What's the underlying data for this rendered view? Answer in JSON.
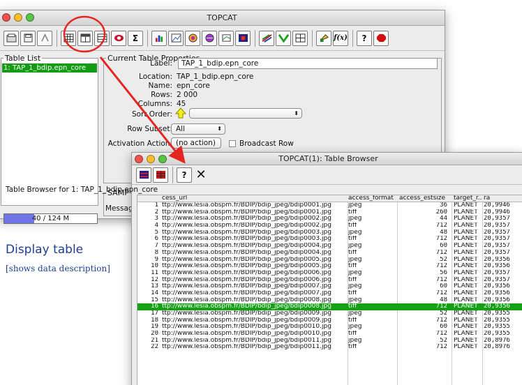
{
  "main_window": {
    "title": "TOPCAT",
    "table_list": {
      "legend": "Table List",
      "items": [
        "1: TAP_1_bdip.epn_core"
      ]
    },
    "memory": {
      "text": "40 / 124 M",
      "fraction": 0.32
    },
    "current_table": {
      "legend": "Current Table Properties",
      "label_caption": "Label:",
      "label_value": "TAP_1_bdip.epn_core",
      "location_caption": "Location:",
      "location_value": "TAP_1_bdip.epn_core",
      "name_caption": "Name:",
      "name_value": "epn_core",
      "rows_caption": "Rows:",
      "rows_value": "2 000",
      "columns_caption": "Columns:",
      "columns_value": "45",
      "sort_caption": "Sort Order:",
      "subset_caption": "Row Subset:",
      "subset_value": "All",
      "activation_caption": "Activation Action:",
      "activation_value": "(no action)",
      "broadcast_label": "Broadcast Row"
    },
    "samp_legend": "SAMP",
    "samp_message": "Messag"
  },
  "callout": {
    "heading": "Display table",
    "subheading": "[shows data description]",
    "colors": {
      "highlight_ring": "#e52521",
      "arrow": "#e52521",
      "text": "#1e3e93"
    }
  },
  "browser_window": {
    "title": "TOPCAT(1): Table Browser",
    "caption": "Table Browser for 1: TAP_1_bdip.epn_core",
    "columns": [
      "",
      "cess_url",
      "access_format",
      "access_estsize",
      "target_r...",
      "ra"
    ],
    "selected_index": 15,
    "rows": [
      {
        "idx": "1",
        "url": "ttp://www.lesia.obspm.fr/BDIP/bdip_jpeg/bdip0001.jpg",
        "format": "jpeg",
        "size": "36",
        "target": "PLANET",
        "ra": "20,9946"
      },
      {
        "idx": "2",
        "url": "ttp://www.lesia.obspm.fr/BDIP/bdip_jpeg/bdip0001.jpg",
        "format": "tiff",
        "size": "260",
        "target": "PLANET",
        "ra": "20,9946"
      },
      {
        "idx": "3",
        "url": "ttp://www.lesia.obspm.fr/BDIP/bdip_jpeg/bdip0002.jpg",
        "format": "jpeg",
        "size": "44",
        "target": "PLANET",
        "ra": "20,9357"
      },
      {
        "idx": "4",
        "url": "ttp://www.lesia.obspm.fr/BDIP/bdip_jpeg/bdip0002.jpg",
        "format": "tiff",
        "size": "712",
        "target": "PLANET",
        "ra": "20,9357"
      },
      {
        "idx": "5",
        "url": "ttp://www.lesia.obspm.fr/BDIP/bdip_jpeg/bdip0003.jpg",
        "format": "jpeg",
        "size": "48",
        "target": "PLANET",
        "ra": "20,9357"
      },
      {
        "idx": "6",
        "url": "ttp://www.lesia.obspm.fr/BDIP/bdip_jpeg/bdip0003.jpg",
        "format": "tiff",
        "size": "712",
        "target": "PLANET",
        "ra": "20,9357"
      },
      {
        "idx": "7",
        "url": "ttp://www.lesia.obspm.fr/BDIP/bdip_jpeg/bdip0004.jpg",
        "format": "jpeg",
        "size": "60",
        "target": "PLANET",
        "ra": "20,9357"
      },
      {
        "idx": "8",
        "url": "ttp://www.lesia.obspm.fr/BDIP/bdip_jpeg/bdip0004.jpg",
        "format": "tiff",
        "size": "712",
        "target": "PLANET",
        "ra": "20,9357"
      },
      {
        "idx": "9",
        "url": "ttp://www.lesia.obspm.fr/BDIP/bdip_jpeg/bdip0005.jpg",
        "format": "jpeg",
        "size": "52",
        "target": "PLANET",
        "ra": "20,9356"
      },
      {
        "idx": "10",
        "url": "ttp://www.lesia.obspm.fr/BDIP/bdip_jpeg/bdip0005.jpg",
        "format": "tiff",
        "size": "712",
        "target": "PLANET",
        "ra": "20,9356"
      },
      {
        "idx": "11",
        "url": "ttp://www.lesia.obspm.fr/BDIP/bdip_jpeg/bdip0006.jpg",
        "format": "jpeg",
        "size": "56",
        "target": "PLANET",
        "ra": "20,9357"
      },
      {
        "idx": "12",
        "url": "ttp://www.lesia.obspm.fr/BDIP/bdip_jpeg/bdip0006.jpg",
        "format": "tiff",
        "size": "712",
        "target": "PLANET",
        "ra": "20,9357"
      },
      {
        "idx": "13",
        "url": "ttp://www.lesia.obspm.fr/BDIP/bdip_jpeg/bdip0007.jpg",
        "format": "jpeg",
        "size": "60",
        "target": "PLANET",
        "ra": "20,9356"
      },
      {
        "idx": "14",
        "url": "ttp://www.lesia.obspm.fr/BDIP/bdip_jpeg/bdip0007.jpg",
        "format": "tiff",
        "size": "712",
        "target": "PLANET",
        "ra": "20,9356"
      },
      {
        "idx": "15",
        "url": "ttp://www.lesia.obspm.fr/BDIP/bdip_jpeg/bdip0008.jpg",
        "format": "jpeg",
        "size": "48",
        "target": "PLANET",
        "ra": "20,9356"
      },
      {
        "idx": "16",
        "url": "ttp://www.lesia.obspm.fr/BDIP/bdip_jpeg/bdip0008.jpg",
        "format": "tiff",
        "size": "712",
        "target": "PLANET",
        "ra": "20,9356"
      },
      {
        "idx": "17",
        "url": "ttp://www.lesia.obspm.fr/BDIP/bdip_jpeg/bdip0009.jpg",
        "format": "jpeg",
        "size": "52",
        "target": "PLANET",
        "ra": "20,9355"
      },
      {
        "idx": "18",
        "url": "ttp://www.lesia.obspm.fr/BDIP/bdip_jpeg/bdip0009.jpg",
        "format": "tiff",
        "size": "712",
        "target": "PLANET",
        "ra": "20,9355"
      },
      {
        "idx": "19",
        "url": "ttp://www.lesia.obspm.fr/BDIP/bdip_jpeg/bdip0010.jpg",
        "format": "jpeg",
        "size": "60",
        "target": "PLANET",
        "ra": "20,9355"
      },
      {
        "idx": "20",
        "url": "ttp://www.lesia.obspm.fr/BDIP/bdip_jpeg/bdip0010.jpg",
        "format": "tiff",
        "size": "712",
        "target": "PLANET",
        "ra": "20,9355"
      },
      {
        "idx": "21",
        "url": "ttp://www.lesia.obspm.fr/BDIP/bdip_jpeg/bdip0011.jpg",
        "format": "jpeg",
        "size": "52",
        "target": "PLANET",
        "ra": "20,8976"
      },
      {
        "idx": "22",
        "url": "ttp://www.lesia.obspm.fr/BDIP/bdip_jpeg/bdip0011.jpg",
        "format": "tiff",
        "size": "712",
        "target": "PLANET",
        "ra": "20,8976"
      }
    ]
  }
}
